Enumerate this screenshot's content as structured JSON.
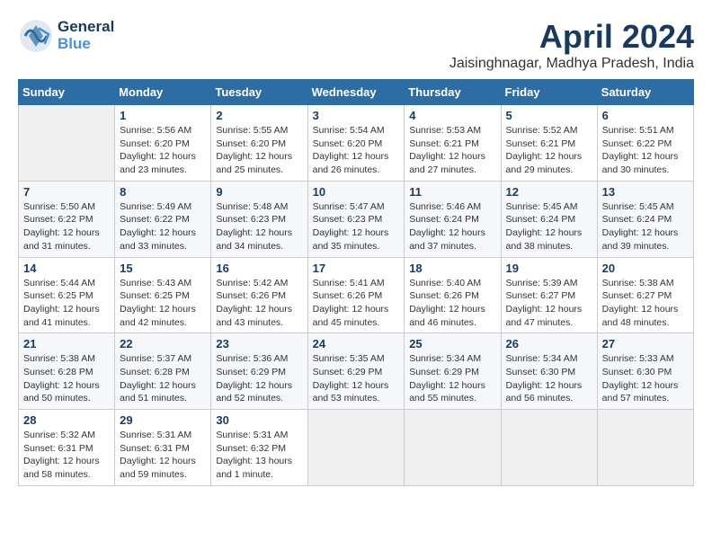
{
  "header": {
    "logo_line1": "General",
    "logo_line2": "Blue",
    "month": "April 2024",
    "location": "Jaisinghnagar, Madhya Pradesh, India"
  },
  "weekdays": [
    "Sunday",
    "Monday",
    "Tuesday",
    "Wednesday",
    "Thursday",
    "Friday",
    "Saturday"
  ],
  "weeks": [
    [
      {
        "day": "",
        "info": ""
      },
      {
        "day": "1",
        "info": "Sunrise: 5:56 AM\nSunset: 6:20 PM\nDaylight: 12 hours\nand 23 minutes."
      },
      {
        "day": "2",
        "info": "Sunrise: 5:55 AM\nSunset: 6:20 PM\nDaylight: 12 hours\nand 25 minutes."
      },
      {
        "day": "3",
        "info": "Sunrise: 5:54 AM\nSunset: 6:20 PM\nDaylight: 12 hours\nand 26 minutes."
      },
      {
        "day": "4",
        "info": "Sunrise: 5:53 AM\nSunset: 6:21 PM\nDaylight: 12 hours\nand 27 minutes."
      },
      {
        "day": "5",
        "info": "Sunrise: 5:52 AM\nSunset: 6:21 PM\nDaylight: 12 hours\nand 29 minutes."
      },
      {
        "day": "6",
        "info": "Sunrise: 5:51 AM\nSunset: 6:22 PM\nDaylight: 12 hours\nand 30 minutes."
      }
    ],
    [
      {
        "day": "7",
        "info": "Sunrise: 5:50 AM\nSunset: 6:22 PM\nDaylight: 12 hours\nand 31 minutes."
      },
      {
        "day": "8",
        "info": "Sunrise: 5:49 AM\nSunset: 6:22 PM\nDaylight: 12 hours\nand 33 minutes."
      },
      {
        "day": "9",
        "info": "Sunrise: 5:48 AM\nSunset: 6:23 PM\nDaylight: 12 hours\nand 34 minutes."
      },
      {
        "day": "10",
        "info": "Sunrise: 5:47 AM\nSunset: 6:23 PM\nDaylight: 12 hours\nand 35 minutes."
      },
      {
        "day": "11",
        "info": "Sunrise: 5:46 AM\nSunset: 6:24 PM\nDaylight: 12 hours\nand 37 minutes."
      },
      {
        "day": "12",
        "info": "Sunrise: 5:45 AM\nSunset: 6:24 PM\nDaylight: 12 hours\nand 38 minutes."
      },
      {
        "day": "13",
        "info": "Sunrise: 5:45 AM\nSunset: 6:24 PM\nDaylight: 12 hours\nand 39 minutes."
      }
    ],
    [
      {
        "day": "14",
        "info": "Sunrise: 5:44 AM\nSunset: 6:25 PM\nDaylight: 12 hours\nand 41 minutes."
      },
      {
        "day": "15",
        "info": "Sunrise: 5:43 AM\nSunset: 6:25 PM\nDaylight: 12 hours\nand 42 minutes."
      },
      {
        "day": "16",
        "info": "Sunrise: 5:42 AM\nSunset: 6:26 PM\nDaylight: 12 hours\nand 43 minutes."
      },
      {
        "day": "17",
        "info": "Sunrise: 5:41 AM\nSunset: 6:26 PM\nDaylight: 12 hours\nand 45 minutes."
      },
      {
        "day": "18",
        "info": "Sunrise: 5:40 AM\nSunset: 6:26 PM\nDaylight: 12 hours\nand 46 minutes."
      },
      {
        "day": "19",
        "info": "Sunrise: 5:39 AM\nSunset: 6:27 PM\nDaylight: 12 hours\nand 47 minutes."
      },
      {
        "day": "20",
        "info": "Sunrise: 5:38 AM\nSunset: 6:27 PM\nDaylight: 12 hours\nand 48 minutes."
      }
    ],
    [
      {
        "day": "21",
        "info": "Sunrise: 5:38 AM\nSunset: 6:28 PM\nDaylight: 12 hours\nand 50 minutes."
      },
      {
        "day": "22",
        "info": "Sunrise: 5:37 AM\nSunset: 6:28 PM\nDaylight: 12 hours\nand 51 minutes."
      },
      {
        "day": "23",
        "info": "Sunrise: 5:36 AM\nSunset: 6:29 PM\nDaylight: 12 hours\nand 52 minutes."
      },
      {
        "day": "24",
        "info": "Sunrise: 5:35 AM\nSunset: 6:29 PM\nDaylight: 12 hours\nand 53 minutes."
      },
      {
        "day": "25",
        "info": "Sunrise: 5:34 AM\nSunset: 6:29 PM\nDaylight: 12 hours\nand 55 minutes."
      },
      {
        "day": "26",
        "info": "Sunrise: 5:34 AM\nSunset: 6:30 PM\nDaylight: 12 hours\nand 56 minutes."
      },
      {
        "day": "27",
        "info": "Sunrise: 5:33 AM\nSunset: 6:30 PM\nDaylight: 12 hours\nand 57 minutes."
      }
    ],
    [
      {
        "day": "28",
        "info": "Sunrise: 5:32 AM\nSunset: 6:31 PM\nDaylight: 12 hours\nand 58 minutes."
      },
      {
        "day": "29",
        "info": "Sunrise: 5:31 AM\nSunset: 6:31 PM\nDaylight: 12 hours\nand 59 minutes."
      },
      {
        "day": "30",
        "info": "Sunrise: 5:31 AM\nSunset: 6:32 PM\nDaylight: 13 hours\nand 1 minute."
      },
      {
        "day": "",
        "info": ""
      },
      {
        "day": "",
        "info": ""
      },
      {
        "day": "",
        "info": ""
      },
      {
        "day": "",
        "info": ""
      }
    ]
  ]
}
